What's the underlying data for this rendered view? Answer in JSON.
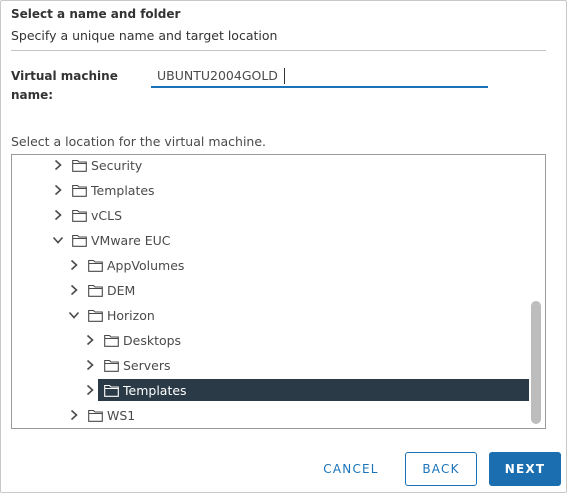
{
  "header": {
    "title": "Select a name and folder",
    "subtitle": "Specify a unique name and target location"
  },
  "vm_name": {
    "label": "Virtual machine name:",
    "value": "UBUNTU2004GOLD"
  },
  "location": {
    "label": "Select a location for the virtual machine.",
    "tree": [
      {
        "label": "Security",
        "expanded": false
      },
      {
        "label": "Templates",
        "expanded": false
      },
      {
        "label": "vCLS",
        "expanded": false
      },
      {
        "label": "VMware EUC",
        "expanded": true
      },
      {
        "label": "AppVolumes",
        "expanded": false
      },
      {
        "label": "DEM",
        "expanded": false
      },
      {
        "label": "Horizon",
        "expanded": true
      },
      {
        "label": "Desktops",
        "expanded": false
      },
      {
        "label": "Servers",
        "expanded": false
      },
      {
        "label": "Templates",
        "expanded": false,
        "selected": true
      },
      {
        "label": "WS1",
        "expanded": false
      }
    ]
  },
  "footer": {
    "cancel": "CANCEL",
    "back": "BACK",
    "next": "NEXT"
  },
  "colors": {
    "accent": "#1b6fb0",
    "selected_row": "#2a3a46"
  }
}
